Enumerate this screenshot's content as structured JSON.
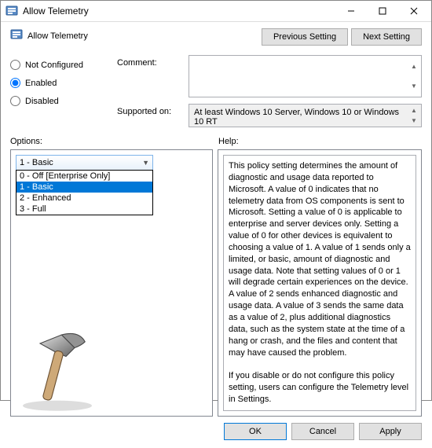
{
  "window": {
    "title": "Allow Telemetry"
  },
  "header": {
    "label": "Allow Telemetry",
    "prev": "Previous Setting",
    "next": "Next Setting"
  },
  "radios": {
    "not_configured": "Not Configured",
    "enabled": "Enabled",
    "disabled": "Disabled"
  },
  "form": {
    "comment_label": "Comment:",
    "comment_value": "",
    "supported_label": "Supported on:",
    "supported_value": "At least Windows 10 Server, Windows 10 or Windows 10 RT"
  },
  "sections": {
    "options": "Options:",
    "help": "Help:"
  },
  "dropdown": {
    "selected": "1 - Basic",
    "items": [
      "0 - Off [Enterprise Only]",
      "1 - Basic",
      "2 - Enhanced",
      "3 - Full"
    ],
    "selected_index": 1
  },
  "help_text": "This policy setting determines the amount of diagnostic and usage data reported to Microsoft. A value of 0 indicates that no telemetry data from OS components is sent to Microsoft. Setting a value of 0 is applicable to enterprise and server devices only. Setting a value of 0 for other devices is equivalent to choosing a value of 1. A value of 1 sends only a limited, or basic, amount of diagnostic and usage data. Note that setting values of 0 or 1 will degrade certain experiences on the device. A value of 2 sends enhanced diagnostic and usage data. A value of 3 sends the same data as a value of 2, plus additional diagnostics data, such as the system state at the time of a hang or crash, and the files and content that may have caused the problem.\n\nIf you disable or do not configure this policy setting, users can configure the Telemetry level in Settings.",
  "buttons": {
    "ok": "OK",
    "cancel": "Cancel",
    "apply": "Apply"
  }
}
